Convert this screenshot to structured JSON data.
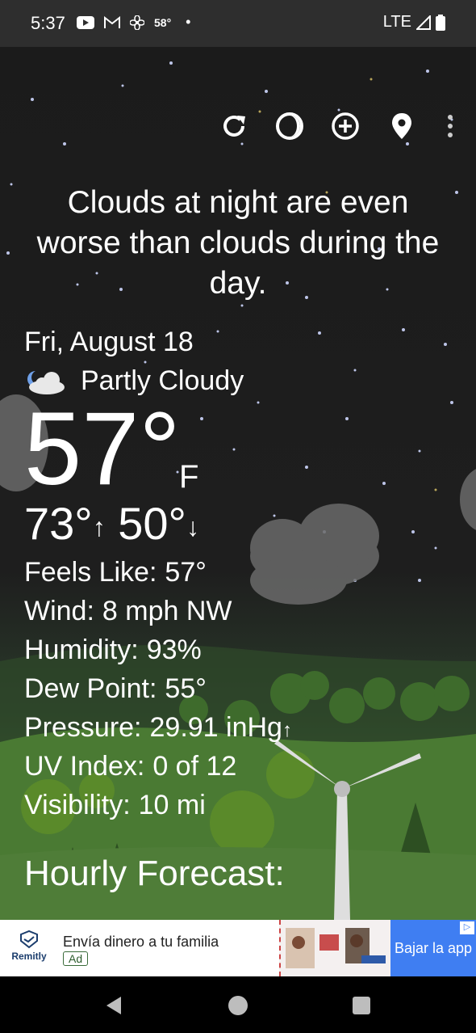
{
  "status_bar": {
    "time": "5:37",
    "weather_temp": "58°",
    "network": "LTE",
    "icons": [
      "youtube-icon",
      "gmail-icon",
      "fan-icon",
      "dot-icon",
      "signal-icon",
      "battery-icon"
    ]
  },
  "toolbar": {
    "icons": [
      "refresh-icon",
      "theme-toggle-icon",
      "add-location-icon",
      "location-pin-icon",
      "more-vert-icon"
    ]
  },
  "quote": "Clouds at night are even worse than clouds during the day.",
  "current": {
    "date": "Fri, August 18",
    "condition": "Partly Cloudy",
    "condition_icon": "partly-cloudy-night-icon",
    "temperature": "57",
    "degree": "°",
    "unit": "F",
    "high": "73°",
    "low": "50°"
  },
  "details": [
    {
      "label": "Feels Like:",
      "value": "57°"
    },
    {
      "label": "Wind:",
      "value": "8 mph NW"
    },
    {
      "label": "Humidity:",
      "value": "93%"
    },
    {
      "label": "Dew Point:",
      "value": "55°"
    },
    {
      "label": "Pressure:",
      "value": "29.91 inHg"
    },
    {
      "label": "UV Index:",
      "value": "0 of 12"
    },
    {
      "label": "Visibility:",
      "value": "10 mi"
    }
  ],
  "hourly_title": "Hourly Forecast:",
  "ad": {
    "brand": "Remitly",
    "headline": "Envía dinero a tu familia",
    "tag": "Ad",
    "cta": "Bajar la app"
  },
  "colors": {
    "status_bar": "#2e2e2e",
    "sky": "#1b1b1b",
    "grass": "#4f7d38",
    "ad_cta": "#3f7ef2"
  }
}
